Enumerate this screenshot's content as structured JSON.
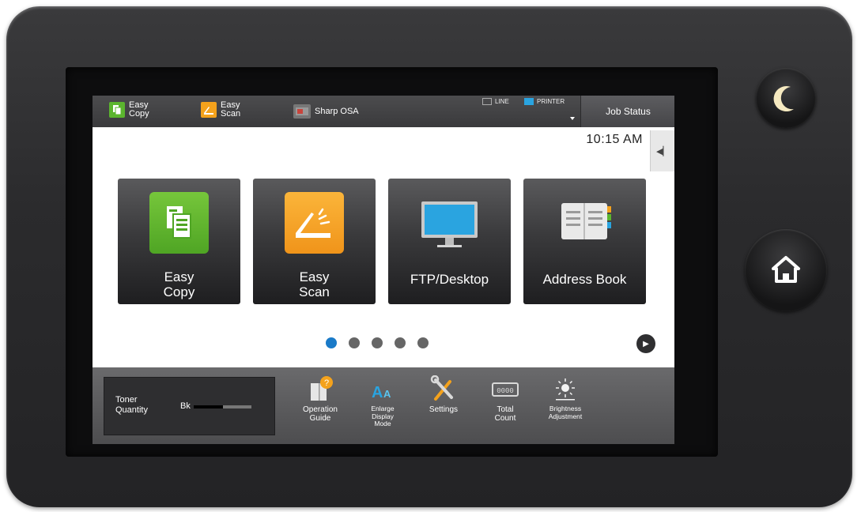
{
  "statusbar": {
    "items": [
      {
        "label_line1": "Easy",
        "label_line2": "Copy",
        "icon": "easy-copy-icon",
        "color": "#5bb52e"
      },
      {
        "label_line1": "Easy",
        "label_line2": "Scan",
        "icon": "easy-scan-icon",
        "color": "#f4a21c"
      },
      {
        "label": "Sharp OSA",
        "icon": "sharp-osa-icon"
      }
    ],
    "indicators": {
      "line": "LINE",
      "printer": "PRINTER"
    },
    "job_status": "Job Status"
  },
  "clock": "10:15 AM",
  "tiles": [
    {
      "label_line1": "Easy",
      "label_line2": "Copy",
      "icon": "copy-icon",
      "color": "#5bb52e"
    },
    {
      "label_line1": "Easy",
      "label_line2": "Scan",
      "icon": "scan-icon",
      "color": "#f4a21c"
    },
    {
      "label": "FTP/Desktop",
      "icon": "monitor-icon",
      "color": "#2aa4e0"
    },
    {
      "label": "Address Book",
      "icon": "address-book-icon"
    }
  ],
  "pager": {
    "pages": 5,
    "active": 1
  },
  "toner": {
    "label_line1": "Toner",
    "label_line2": "Quantity",
    "color_label": "Bk",
    "level": 0.5
  },
  "tools": [
    {
      "label_line1": "Operation",
      "label_line2": "Guide",
      "icon": "operation-guide-icon"
    },
    {
      "label_line1": "Enlarge",
      "label_line2": "Display",
      "label_line3": "Mode",
      "icon": "enlarge-display-icon"
    },
    {
      "label": "Settings",
      "icon": "settings-icon"
    },
    {
      "label_line1": "Total",
      "label_line2": "Count",
      "icon": "total-count-icon",
      "counter": "0000"
    },
    {
      "label_line1": "Brightness",
      "label_line2": "Adjustment",
      "icon": "brightness-icon"
    }
  ],
  "colors": {
    "accent": "#1a7ac8",
    "green": "#5bb52e",
    "orange": "#f4a21c",
    "blue": "#2aa4e0"
  }
}
